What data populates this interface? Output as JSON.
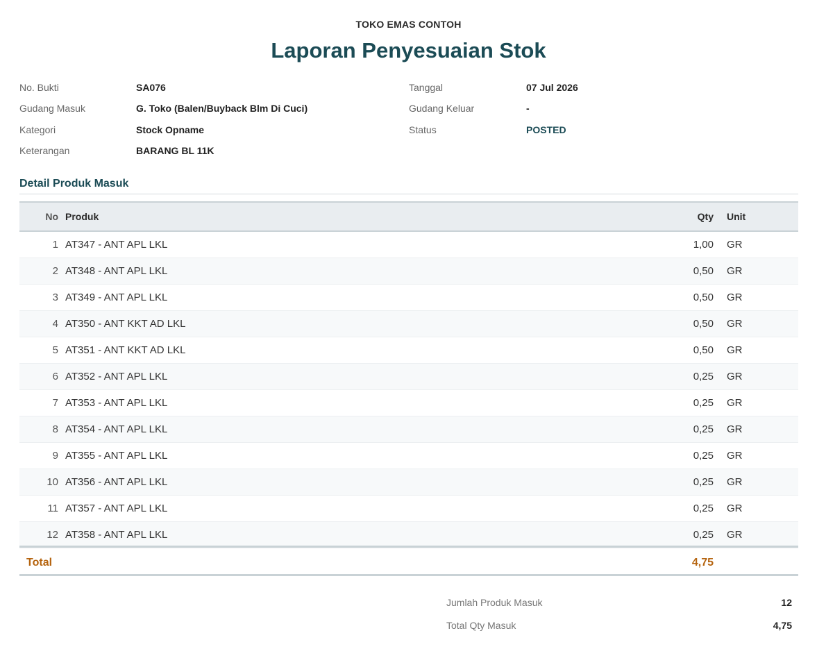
{
  "company": "TOKO EMAS CONTOH",
  "title": "Laporan Penyesuaian Stok",
  "meta": {
    "no_bukti_label": "No. Bukti",
    "no_bukti": "SA076",
    "tanggal_label": "Tanggal",
    "tanggal": "07 Jul 2026",
    "gudang_masuk_label": "Gudang Masuk",
    "gudang_masuk": "G. Toko (Balen/Buyback Blm Di Cuci)",
    "gudang_keluar_label": "Gudang Keluar",
    "gudang_keluar": "-",
    "kategori_label": "Kategori",
    "kategori": "Stock Opname",
    "status_label": "Status",
    "status": "POSTED",
    "keterangan_label": "Keterangan",
    "keterangan": "BARANG BL 11K"
  },
  "section_title": "Detail Produk Masuk",
  "table": {
    "headers": {
      "no": "No",
      "produk": "Produk",
      "qty": "Qty",
      "unit": "Unit"
    },
    "rows": [
      {
        "no": "1",
        "produk": "AT347 - ANT APL LKL",
        "qty": "1,00",
        "unit": "GR"
      },
      {
        "no": "2",
        "produk": "AT348 - ANT APL LKL",
        "qty": "0,50",
        "unit": "GR"
      },
      {
        "no": "3",
        "produk": "AT349 - ANT APL LKL",
        "qty": "0,50",
        "unit": "GR"
      },
      {
        "no": "4",
        "produk": "AT350 - ANT KKT AD LKL",
        "qty": "0,50",
        "unit": "GR"
      },
      {
        "no": "5",
        "produk": "AT351 - ANT KKT AD LKL",
        "qty": "0,50",
        "unit": "GR"
      },
      {
        "no": "6",
        "produk": "AT352 - ANT APL LKL",
        "qty": "0,25",
        "unit": "GR"
      },
      {
        "no": "7",
        "produk": "AT353 - ANT APL LKL",
        "qty": "0,25",
        "unit": "GR"
      },
      {
        "no": "8",
        "produk": "AT354 - ANT APL LKL",
        "qty": "0,25",
        "unit": "GR"
      },
      {
        "no": "9",
        "produk": "AT355 - ANT APL LKL",
        "qty": "0,25",
        "unit": "GR"
      },
      {
        "no": "10",
        "produk": "AT356 - ANT APL LKL",
        "qty": "0,25",
        "unit": "GR"
      },
      {
        "no": "11",
        "produk": "AT357 - ANT APL LKL",
        "qty": "0,25",
        "unit": "GR"
      },
      {
        "no": "12",
        "produk": "AT358 - ANT APL LKL",
        "qty": "0,25",
        "unit": "GR"
      }
    ],
    "total_label": "Total",
    "total_qty": "4,75"
  },
  "summary": {
    "jumlah_label": "Jumlah Produk Masuk",
    "jumlah": "12",
    "total_qty_label": "Total Qty Masuk",
    "total_qty": "4,75"
  },
  "colors": {
    "accent": "#1b4b55",
    "total": "#b5640f",
    "header_bg": "#e9edf0"
  }
}
